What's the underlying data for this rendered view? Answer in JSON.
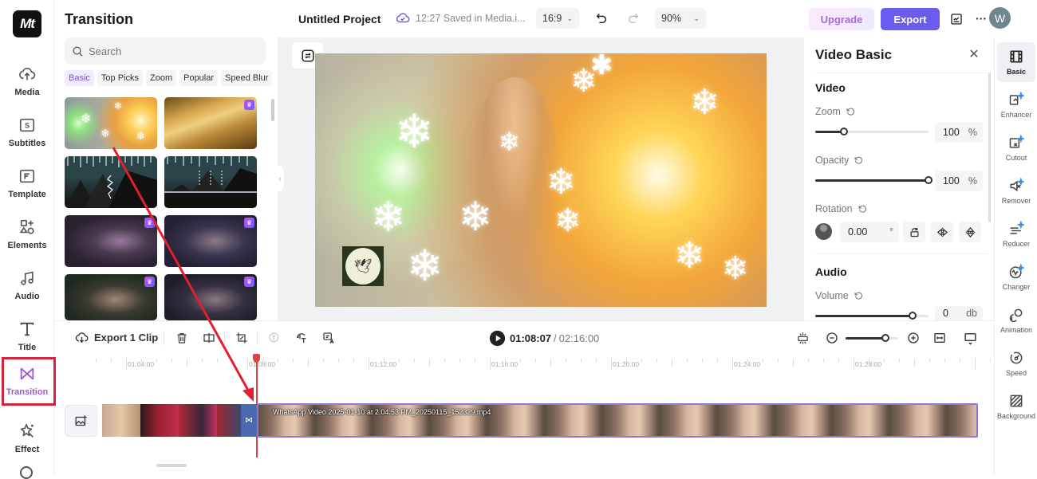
{
  "app": {
    "logo_text": "Mt"
  },
  "leftnav": {
    "items": [
      {
        "label": "Media",
        "icon": "cloud-upload-icon"
      },
      {
        "label": "Subtitles",
        "icon": "subtitles-icon"
      },
      {
        "label": "Template",
        "icon": "template-icon"
      },
      {
        "label": "Elements",
        "icon": "elements-icon"
      },
      {
        "label": "Audio",
        "icon": "music-note-icon"
      },
      {
        "label": "Title",
        "icon": "title-t-icon"
      },
      {
        "label": "Transition",
        "icon": "transition-bowtie-icon",
        "active": true
      },
      {
        "label": "Effect",
        "icon": "effect-star-icon"
      }
    ]
  },
  "transition_panel": {
    "title": "Transition",
    "search_placeholder": "Search",
    "categories": [
      "Basic",
      "Top Picks",
      "Zoom",
      "Popular",
      "Speed Blur"
    ],
    "active_category": "Basic",
    "thumbnails": [
      {
        "name": "snowflake-sparkle",
        "premium": false
      },
      {
        "name": "golden-glitter",
        "premium": true
      },
      {
        "name": "zigzag-drop",
        "premium": false
      },
      {
        "name": "arrow-drop",
        "premium": false
      },
      {
        "name": "dreamy-fade-1",
        "premium": true
      },
      {
        "name": "dreamy-fade-2",
        "premium": true
      },
      {
        "name": "dreamy-fade-3",
        "premium": true
      },
      {
        "name": "dreamy-fade-4",
        "premium": true
      }
    ]
  },
  "topbar": {
    "project_title": "Untitled Project",
    "save_status": "12:27 Saved in Media.i...",
    "aspect_ratio": "16:9",
    "zoom": "90%",
    "upgrade_label": "Upgrade",
    "export_label": "Export",
    "avatar_initial": "W"
  },
  "properties": {
    "title": "Video Basic",
    "video_section": "Video",
    "zoom_label": "Zoom",
    "zoom_value": "100",
    "zoom_unit": "%",
    "zoom_slider_fraction": 0.25,
    "opacity_label": "Opacity",
    "opacity_value": "100",
    "opacity_unit": "%",
    "opacity_slider_fraction": 1.0,
    "rotation_label": "Rotation",
    "rotation_value": "0.00",
    "rotation_unit": "°",
    "audio_section": "Audio",
    "volume_label": "Volume",
    "volume_value": "0",
    "volume_unit": "db",
    "volume_slider_fraction": 0.86
  },
  "tools": [
    {
      "label": "Basic",
      "active": true
    },
    {
      "label": "Enhancer"
    },
    {
      "label": "Cutout"
    },
    {
      "label": "Remover"
    },
    {
      "label": "Reducer"
    },
    {
      "label": "Changer"
    },
    {
      "label": "Animation"
    },
    {
      "label": "Speed"
    },
    {
      "label": "Background"
    }
  ],
  "timeline": {
    "export_clip_label": "Export 1 Clip",
    "current_time": "01:08:07",
    "separator": "/",
    "total_time": "02:16:00",
    "zoom_slider_fraction": 0.75,
    "ruler_labels": [
      "01:04:00",
      "01:08:00",
      "01:12:00",
      "01:16:00",
      "01:20:00",
      "01:24:00",
      "01:28:00"
    ],
    "clip_name": "WhatsApp Video 2025-01-10 at 2.04.53 PM_20250115_152329.mp4"
  }
}
